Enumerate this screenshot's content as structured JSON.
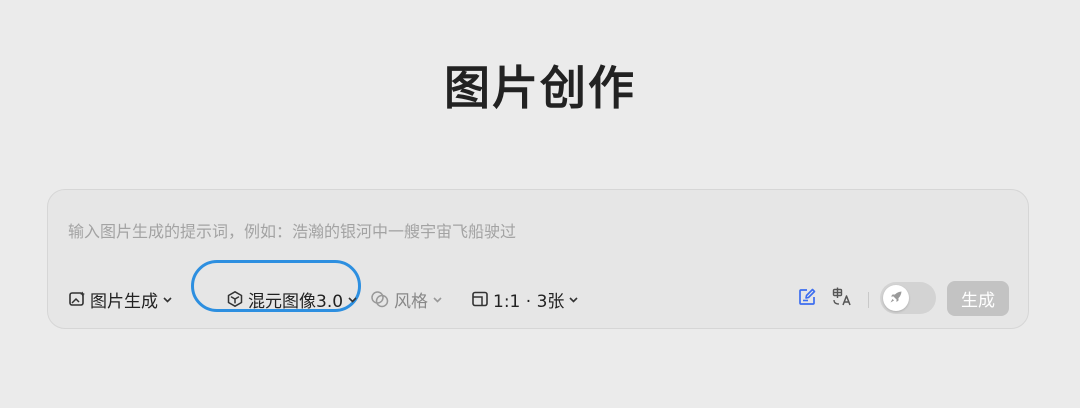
{
  "page": {
    "title": "图片创作"
  },
  "prompt": {
    "value": "",
    "placeholder": "输入图片生成的提示词，例如：浩瀚的银河中一艘宇宙飞船驶过"
  },
  "toolbar": {
    "mode_label": "图片生成",
    "model_label": "混元图像3.0",
    "style_label": "风格",
    "ratio_label": "1:1 · 3张",
    "generate_label": "生成",
    "toggle_on": false
  },
  "icons": {
    "mode": "image-sparkle-icon",
    "model": "cube-icon",
    "style": "overlap-circles-icon",
    "ratio": "aspect-ratio-icon",
    "edit": "edit-prompt-icon",
    "translate": "translate-icon",
    "toggle": "rocket-icon",
    "chevron": "chevron-down-icon"
  },
  "colors": {
    "background": "#ebebeb",
    "highlight_ring": "#2d8fe0",
    "edit_icon": "#3c6df0",
    "generate_disabled": "#c3c3c3"
  }
}
